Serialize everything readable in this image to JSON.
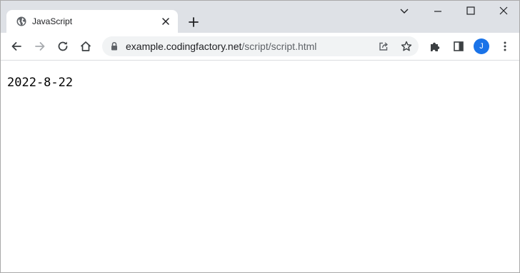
{
  "browser": {
    "tab": {
      "title": "JavaScript",
      "favicon": "globe-icon"
    },
    "address_bar": {
      "host": "example.codingfactory.net",
      "path": "/script/script.html"
    },
    "profile": {
      "initial": "J",
      "color": "#1a73e8"
    },
    "icons": {
      "back": "back-arrow-icon",
      "forward": "forward-arrow-icon",
      "reload": "reload-icon",
      "home": "home-icon",
      "lock": "lock-icon",
      "share": "share-icon",
      "bookmark": "star-icon",
      "extensions": "puzzle-icon",
      "side_panel": "side-panel-icon",
      "menu": "more-vert-icon",
      "minimize": "minimize-icon",
      "maximize": "maximize-icon",
      "close": "close-icon",
      "tab_search": "chevron-down-icon",
      "new_tab": "plus-icon"
    }
  },
  "page": {
    "output_text": "2022-8-22"
  }
}
